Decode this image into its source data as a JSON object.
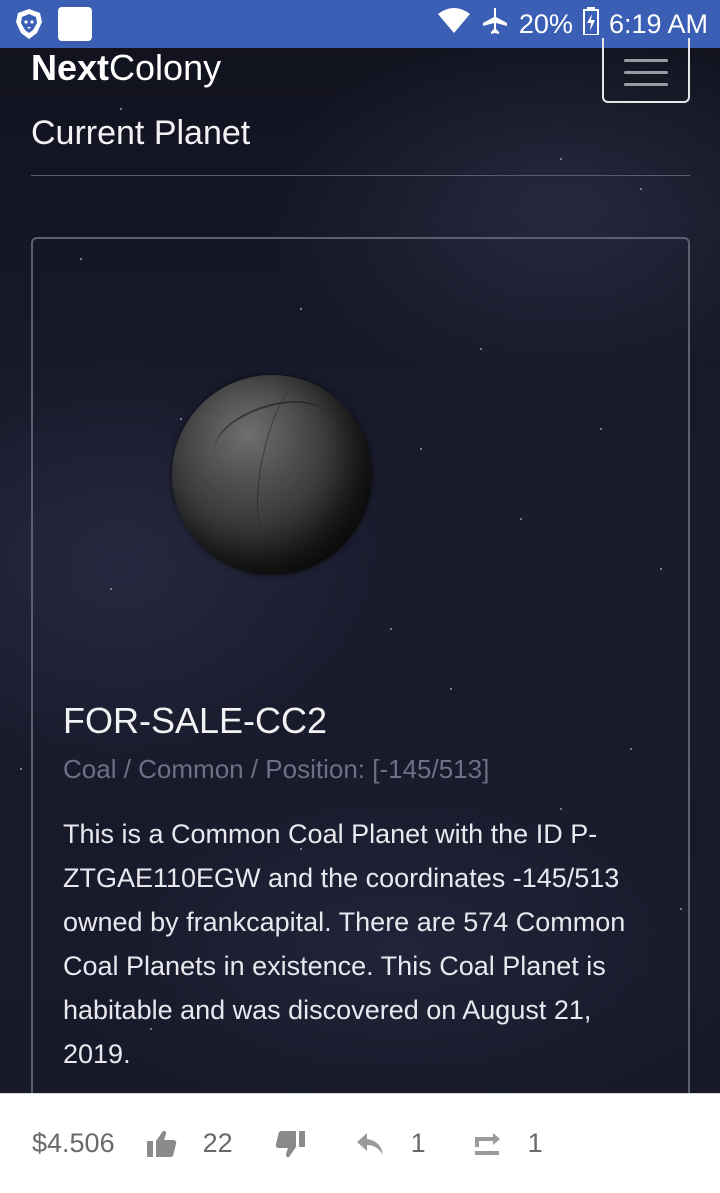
{
  "status_bar": {
    "battery": "20%",
    "time": "6:19 AM"
  },
  "header": {
    "brand_bold": "Next",
    "brand_rest": "Colony"
  },
  "page": {
    "section_title": "Current Planet"
  },
  "planet": {
    "name": "FOR-SALE-CC2",
    "meta": "Coal / Common / Position: [-145/513]",
    "description": "This is a Common Coal Planet with the ID P-ZTGAE110EGW and the coordinates -145/513 owned by frankcapital. There are 574 Common Coal Planets in existence. This Coal Planet is habitable and was discovered on August 21, 2019."
  },
  "actions": {
    "payout": "$4.506",
    "upvotes": "22",
    "replies": "1",
    "resteems": "1"
  },
  "colors": {
    "status_bar": "#3a5fb4",
    "background": "#141624",
    "card_border": "#5c5f70",
    "muted_text": "#6e7183"
  }
}
